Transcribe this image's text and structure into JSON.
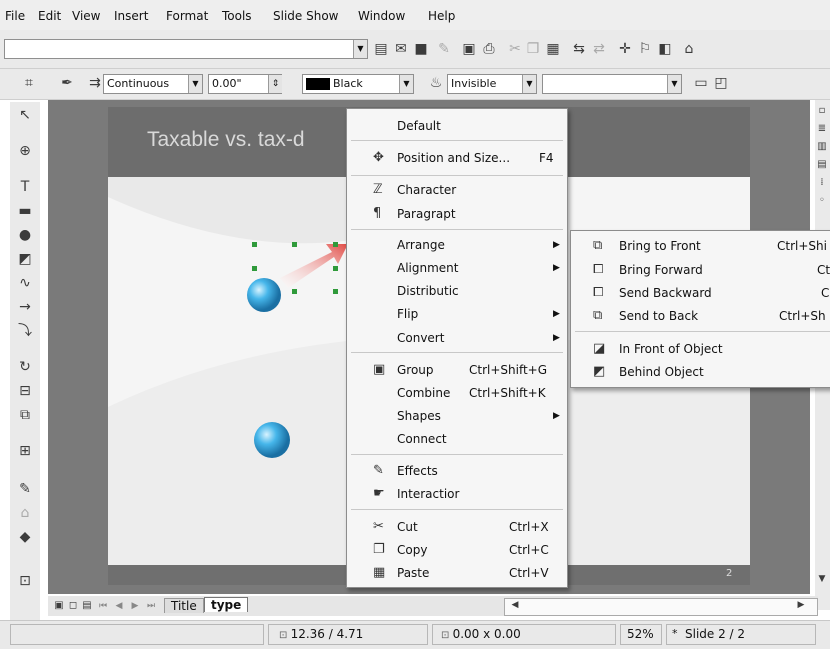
{
  "menubar": {
    "items": [
      "File",
      "Edit",
      "View",
      "Insert",
      "Format",
      "Tools",
      "Slide Show",
      "Window",
      "Help"
    ]
  },
  "toolbar2": {
    "line_style": "Continuous",
    "line_width": "0.00\"",
    "line_color": "Black",
    "area_style": "Invisible"
  },
  "slide": {
    "title": "Taxable vs. tax-d",
    "page_number": "2"
  },
  "context_menu": {
    "default": "Default",
    "position_size": "Position and Size...",
    "position_size_shortcut": "F4",
    "character": "Character",
    "paragraph": "Paragrapt",
    "arrange": "Arrange",
    "alignment": "Alignment",
    "distribution": "Distributic",
    "flip": "Flip",
    "convert": "Convert",
    "group": "Group",
    "group_shortcut": "Ctrl+Shift+G",
    "combine": "Combine",
    "combine_shortcut": "Ctrl+Shift+K",
    "shapes": "Shapes",
    "connect": "Connect",
    "effects": "Effects",
    "interaction": "Interactior",
    "cut": "Cut",
    "cut_shortcut": "Ctrl+X",
    "copy": "Copy",
    "copy_shortcut": "Ctrl+C",
    "paste": "Paste",
    "paste_shortcut": "Ctrl+V"
  },
  "arrange_menu": {
    "bring_to_front": "Bring to Front",
    "bring_to_front_shortcut": "Ctrl+Shi",
    "bring_forward": "Bring Forward",
    "bring_forward_shortcut": "Ct",
    "send_backward": "Send Backward",
    "send_backward_shortcut": "C",
    "send_to_back": "Send to Back",
    "send_to_back_shortcut": "Ctrl+Sh",
    "in_front_of_object": "In Front of Object",
    "behind_object": "Behind Object"
  },
  "tabs": {
    "title": "Title",
    "type": "type"
  },
  "status": {
    "position": "12.36 / 4.71",
    "size": "0.00 x 0.00",
    "zoom": "52%",
    "slide": "Slide 2 / 2"
  },
  "colors": {
    "slide_header": "#6d6d6d",
    "canvas_bg": "#7a7a7a",
    "sphere_blue": "#3fa9e0",
    "handle_green": "#2f9a3a"
  }
}
